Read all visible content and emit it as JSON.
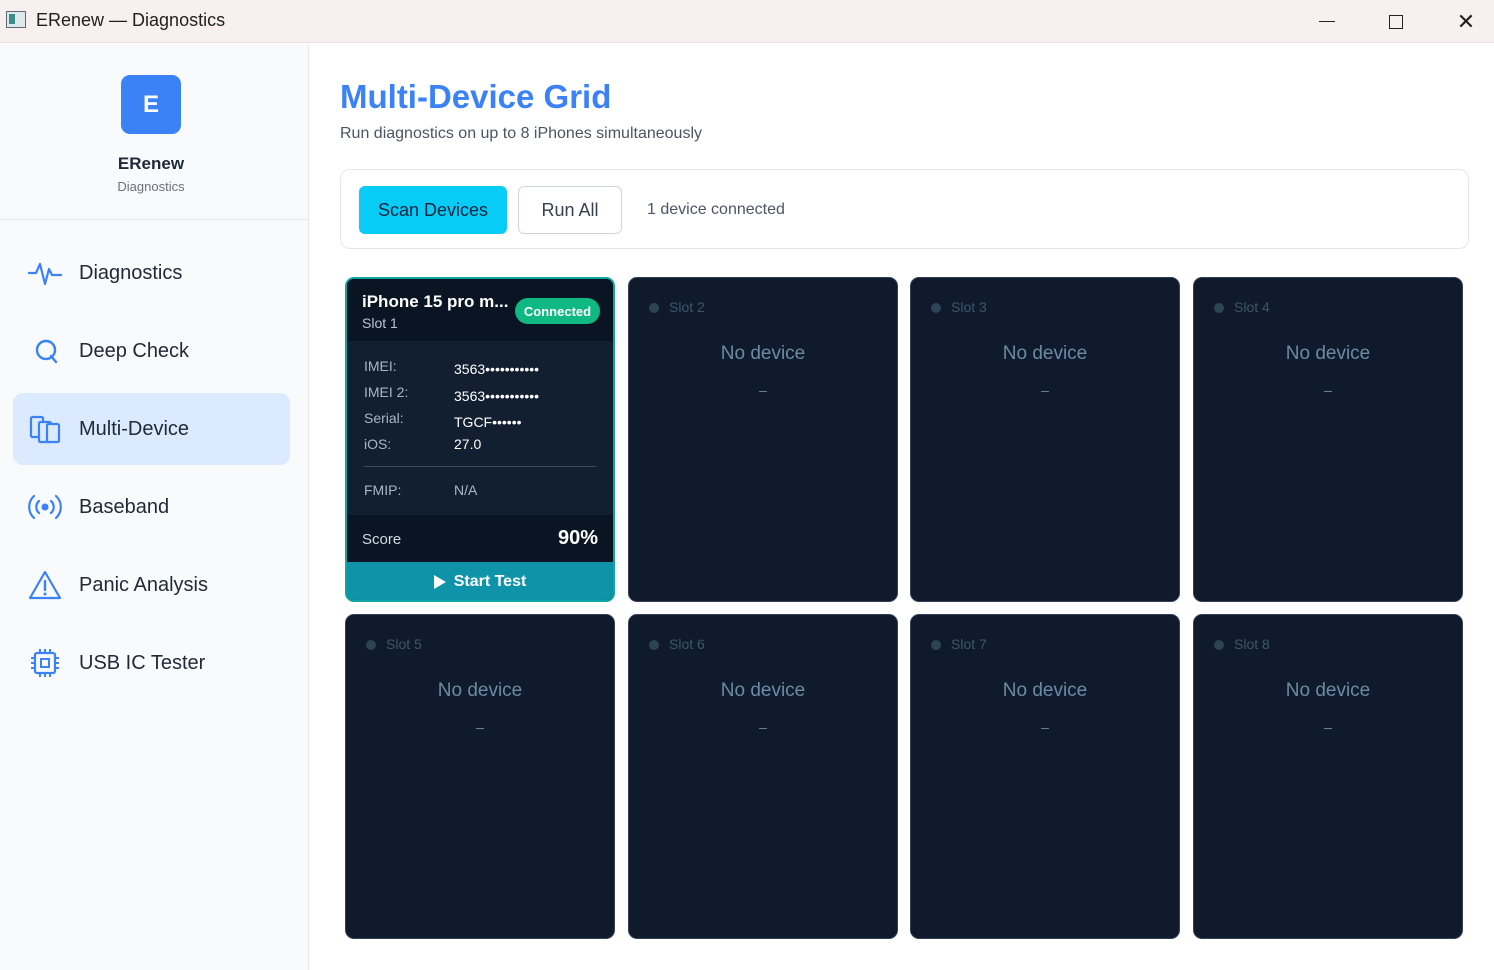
{
  "window": {
    "title": "ERenew — Diagnostics"
  },
  "brand": {
    "logo_letter": "E",
    "name": "ERenew",
    "subtitle": "Diagnostics"
  },
  "nav": [
    {
      "label": "Diagnostics",
      "icon": "pulse-icon",
      "active": false
    },
    {
      "label": "Deep Check",
      "icon": "search-q-icon",
      "active": false
    },
    {
      "label": "Multi-Device",
      "icon": "devices-icon",
      "active": true
    },
    {
      "label": "Baseband",
      "icon": "signal-icon",
      "active": false
    },
    {
      "label": "Panic Analysis",
      "icon": "warning-icon",
      "active": false
    },
    {
      "label": "USB IC Tester",
      "icon": "chip-icon",
      "active": false
    }
  ],
  "main": {
    "title": "Multi-Device Grid",
    "subtitle": "Run diagnostics on up to 8 iPhones simultaneously",
    "toolbar": {
      "scan_label": "Scan Devices",
      "run_all_label": "Run All",
      "status": "1 device connected"
    },
    "active_device": {
      "name": "iPhone 15 pro m...",
      "slot": "Slot 1",
      "status": "Connected",
      "imei_label": "IMEI:",
      "imei": "3563•••••••••••",
      "imei2_label": "IMEI 2:",
      "imei2": "3563•••••••••••",
      "serial_label": "Serial:",
      "serial": "TGCF••••••",
      "ios_label": "iOS:",
      "ios": "27.0",
      "fmip_label": "FMIP:",
      "fmip": "N/A",
      "score_label": "Score",
      "score": "90%",
      "action_label": "Start Test"
    },
    "empty_slots": [
      {
        "slot": "Slot 2",
        "message": "No device",
        "detail": "–"
      },
      {
        "slot": "Slot 3",
        "message": "No device",
        "detail": "–"
      },
      {
        "slot": "Slot 4",
        "message": "No device",
        "detail": "–"
      },
      {
        "slot": "Slot 5",
        "message": "No device",
        "detail": "–"
      },
      {
        "slot": "Slot 6",
        "message": "No device",
        "detail": "–"
      },
      {
        "slot": "Slot 7",
        "message": "No device",
        "detail": "–"
      },
      {
        "slot": "Slot 8",
        "message": "No device",
        "detail": "–"
      }
    ]
  },
  "colors": {
    "accent": "#3b82f6",
    "scan_button": "#06ccf6",
    "connected": "#10b981",
    "card_bg": "#0f1b2d",
    "start_button": "#0e93a8"
  }
}
